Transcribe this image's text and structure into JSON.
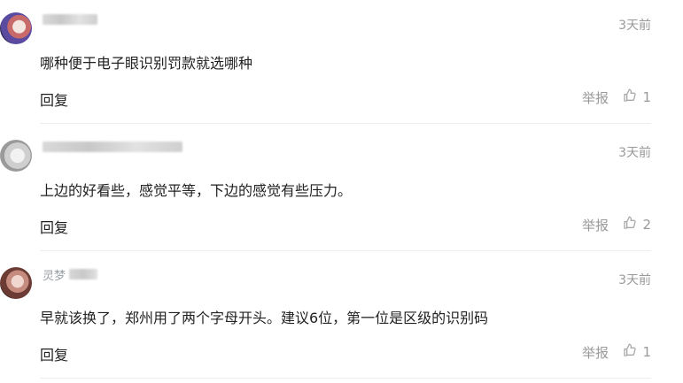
{
  "comments": [
    {
      "time": "3天前",
      "content": "哪种便于电子眼识别罚款就选哪种",
      "reply_label": "回复",
      "report_label": "举报",
      "likes": "1"
    },
    {
      "time": "3天前",
      "content": "上边的好看些，感觉平等，下边的感觉有些压力。",
      "reply_label": "回复",
      "report_label": "举报",
      "likes": "2"
    },
    {
      "name_partial": "灵梦",
      "time": "3天前",
      "content": "早就该换了，郑州用了两个字母开头。建议6位，第一位是区级的识别码",
      "reply_label": "回复",
      "report_label": "举报",
      "likes": "1"
    }
  ],
  "icons": {
    "like": "thumbs-up-icon"
  },
  "colors": {
    "muted": "#999999",
    "text": "#222222",
    "divider": "#eeeeee"
  }
}
